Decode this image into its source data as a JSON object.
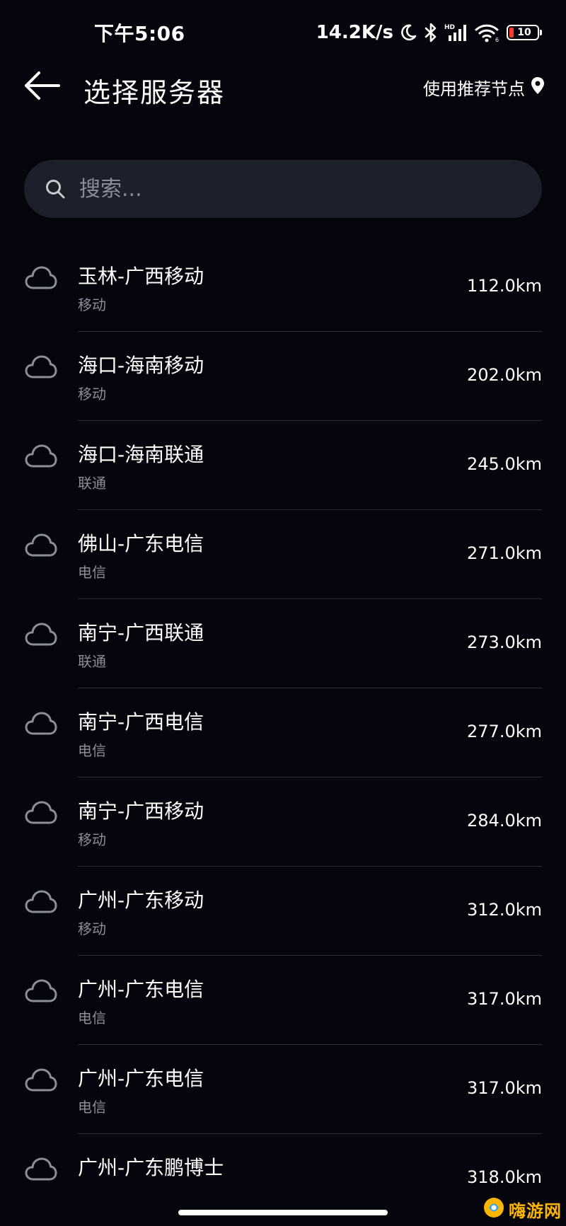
{
  "status_bar": {
    "time": "下午5:06",
    "network_speed": "14.2K/s",
    "battery_level": "10",
    "battery_color": "#ff3b30",
    "icons": [
      "moon-icon",
      "bluetooth-icon",
      "signal-hd-icon",
      "wifi-icon",
      "battery-icon"
    ]
  },
  "header": {
    "title": "选择服务器",
    "recommend_label": "使用推荐节点",
    "back_icon": "arrow-left-icon",
    "recommend_icon": "location-pin-icon"
  },
  "search": {
    "placeholder": "搜索..."
  },
  "servers": [
    {
      "name": "玉林-广西移动",
      "isp": "移动",
      "distance": "112.0km"
    },
    {
      "name": "海口-海南移动",
      "isp": "移动",
      "distance": "202.0km"
    },
    {
      "name": "海口-海南联通",
      "isp": "联通",
      "distance": "245.0km"
    },
    {
      "name": "佛山-广东电信",
      "isp": "电信",
      "distance": "271.0km"
    },
    {
      "name": "南宁-广西联通",
      "isp": "联通",
      "distance": "273.0km"
    },
    {
      "name": "南宁-广西电信",
      "isp": "电信",
      "distance": "277.0km"
    },
    {
      "name": "南宁-广西移动",
      "isp": "移动",
      "distance": "284.0km"
    },
    {
      "name": "广州-广东移动",
      "isp": "移动",
      "distance": "312.0km"
    },
    {
      "name": "广州-广东电信",
      "isp": "电信",
      "distance": "317.0km"
    },
    {
      "name": "广州-广东电信",
      "isp": "电信",
      "distance": "317.0km"
    },
    {
      "name": "广州-广东鹏博士",
      "isp": "",
      "distance": "318.0km"
    }
  ],
  "watermark": {
    "text": "嗨游网",
    "brand_color": "#ffb400"
  },
  "colors": {
    "background": "#05060d",
    "search_background": "#1d1f2a",
    "secondary_text": "#8b8e98",
    "divider": "#2a2c36"
  }
}
